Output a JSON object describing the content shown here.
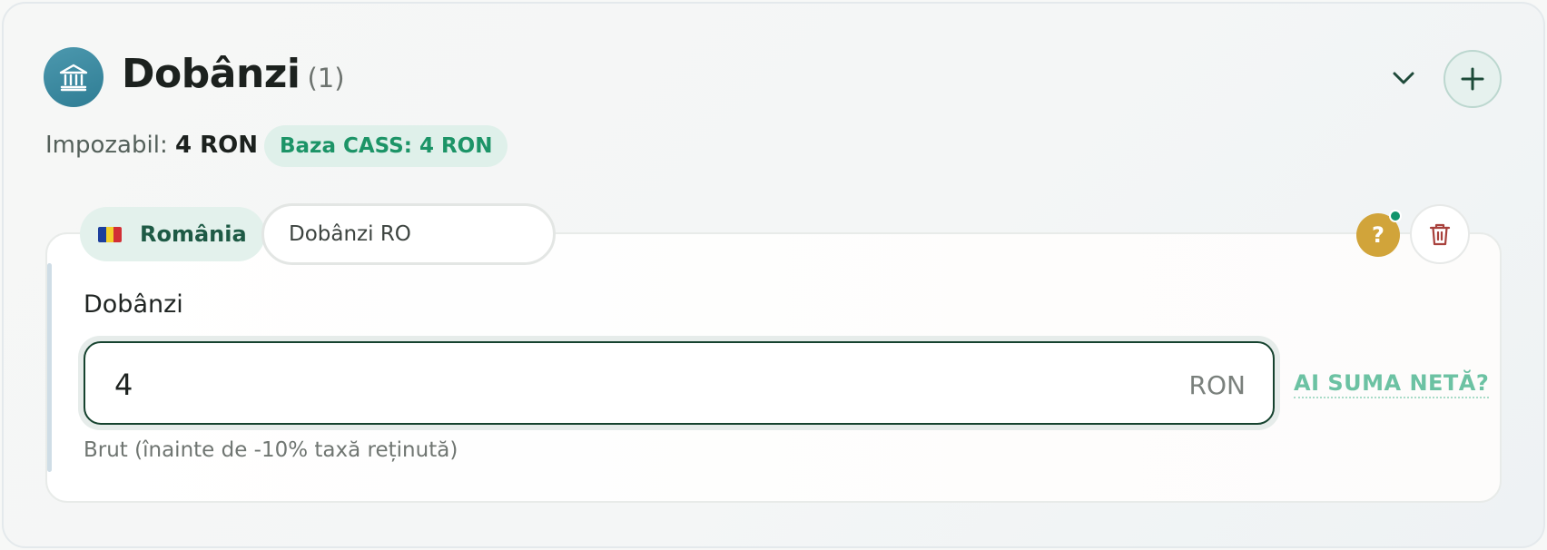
{
  "section": {
    "title": "Dobânzi",
    "count": "(1)",
    "icon": "bank-icon",
    "chevron_icon": "chevron-down-icon",
    "add_icon": "plus-icon"
  },
  "summary": {
    "taxable_label": "Impozabil:",
    "taxable_value": "4 RON",
    "cass_label": "Baza CASS: 4 RON"
  },
  "entry": {
    "country": "România",
    "country_flag": "romania-flag-icon",
    "name_value": "Dobânzi RO",
    "help_label": "?",
    "delete_icon": "trash-icon",
    "field_label": "Dobânzi",
    "amount_value": "4",
    "amount_unit": "RON",
    "net_link": "AI SUMA NETĂ?",
    "hint": "Brut (înainte de -10% taxă reținută)"
  },
  "colors": {
    "accent_teal": "#2f7d94",
    "accent_green": "#1c9467",
    "help_yellow": "#d1a43a",
    "delete_red": "#a8413c",
    "focus_border": "#16432f"
  }
}
